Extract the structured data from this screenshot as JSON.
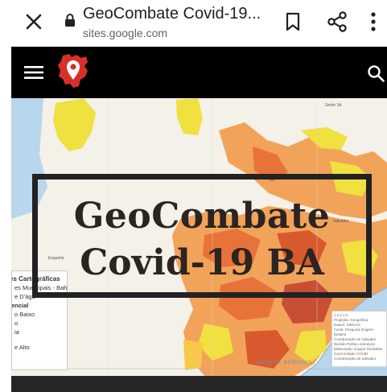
{
  "browser": {
    "page_title": "GeoCombate Covid-19...",
    "domain": "sites.google.com"
  },
  "hero": {
    "title_line1": "GeoCombate",
    "title_line2": "Covid-19 BA"
  },
  "map": {
    "legend_title": "es Cartográficas",
    "legend_items": [
      "es Municipais - Bahia",
      "e D'águ",
      "lencial",
      "o Baixo",
      "o",
      "ia",
      "e Alto"
    ],
    "place_north": "Sento Sé",
    "place_salvador": "Salvador",
    "place_west": "Esquetio",
    "ocean_label": "Oceano Atlântico",
    "info_lines": [
      "1:2 2 1:2",
      "Projeção: Geográfica",
      "Datum: SIRGAS",
      "Fonte: Pesquisa Origem-Destino",
      "Coordenação de Salvador",
      "Divisão Político estrutural",
      "Elaboração: Equipe Geobahia",
      "GeoCombate COVID",
      "Coordenação de Salvador"
    ]
  },
  "colors": {
    "header_bg": "#000000",
    "logo_red": "#d6302b",
    "title_text": "#2b2420",
    "water": "#b8d6ec",
    "land": "#f4f1e8"
  },
  "icons": [
    "close-icon",
    "lock-icon",
    "bookmark-icon",
    "share-icon",
    "more-vert-icon",
    "menu-icon",
    "search-icon"
  ]
}
